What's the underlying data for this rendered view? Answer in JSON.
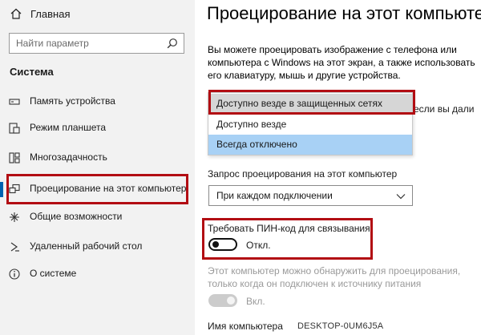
{
  "sidebar": {
    "home_label": "Главная",
    "search": {
      "placeholder": "Найти параметр"
    },
    "section_title": "Система",
    "items": [
      {
        "label": "Память устройства",
        "icon": "storage-icon",
        "active": false
      },
      {
        "label": "Режим планшета",
        "icon": "tablet-mode-icon",
        "active": false
      },
      {
        "label": "Многозадачность",
        "icon": "multitasking-icon",
        "active": false
      },
      {
        "label": "Проецирование на этот компьютер",
        "icon": "projecting-icon",
        "active": true
      },
      {
        "label": "Общие возможности",
        "icon": "shared-experiences-icon",
        "active": false
      },
      {
        "label": "Удаленный рабочий стол",
        "icon": "remote-desktop-icon",
        "active": false
      },
      {
        "label": "О системе",
        "icon": "info-icon",
        "active": false
      }
    ]
  },
  "main": {
    "title": "Проецирование на этот компьютер",
    "description": "Вы можете проецировать изображение с телефона или компьютера с Windows на этот экран, а также использовать его клавиатуру, мышь и другие устройства.",
    "availability_options": [
      "Доступно везде в защищенных сетях",
      "Доступно везде",
      "Всегда отключено"
    ],
    "hidden_text_peek": "если вы дали",
    "projection_request_label": "Запрос проецирования на этот компьютер",
    "projection_request_value": "При каждом подключении",
    "pin_label": "Требовать ПИН-код для связывания",
    "pin_toggle_state": "Откл.",
    "discover_hint": "Этот компьютер можно обнаружить для проецирования, только когда он подключен к источнику питания",
    "power_toggle_state": "Вкл.",
    "pc_name_label": "Имя компьютера",
    "pc_name_value": "DESKTOP-0UM6J5A"
  },
  "colors": {
    "accent": "#0063b1",
    "highlight_box": "#b20d13",
    "selected_option": "#a8d1f5",
    "hover_option": "#d6d6d6",
    "sidebar_bg": "#f2f2f2"
  }
}
